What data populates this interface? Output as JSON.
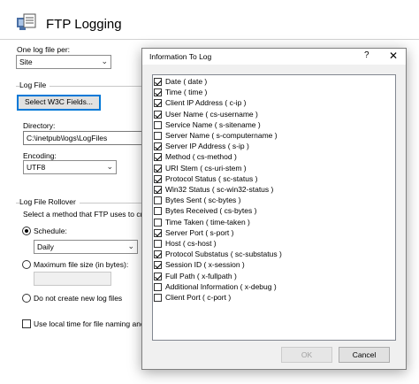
{
  "page": {
    "title": "FTP Logging",
    "one_log_label": "One log file per:",
    "one_log_value": "Site",
    "log_file_group": "Log File",
    "select_fields_button": "Select W3C Fields...",
    "directory_label": "Directory:",
    "directory_value": "C:\\inetpub\\logs\\LogFiles",
    "encoding_label": "Encoding:",
    "encoding_value": "UTF8",
    "rollover_group": "Log File Rollover",
    "rollover_desc": "Select a method that FTP uses to creat",
    "schedule_label": "Schedule:",
    "schedule_value": "Daily",
    "max_size_label": "Maximum file size (in bytes):",
    "no_new_label": "Do not create new log files",
    "local_time_label": "Use local time for file naming and r"
  },
  "dialog": {
    "title": "Information To Log",
    "help_label": "?",
    "close_label": "✕",
    "ok_label": "OK",
    "cancel_label": "Cancel",
    "fields": [
      {
        "label": "Date ( date )",
        "checked": true
      },
      {
        "label": "Time ( time )",
        "checked": true
      },
      {
        "label": "Client IP Address ( c-ip )",
        "checked": true
      },
      {
        "label": "User Name ( cs-username )",
        "checked": true
      },
      {
        "label": "Service Name ( s-sitename )",
        "checked": false
      },
      {
        "label": "Server Name ( s-computername )",
        "checked": false
      },
      {
        "label": "Server IP Address ( s-ip )",
        "checked": true
      },
      {
        "label": "Method ( cs-method )",
        "checked": true
      },
      {
        "label": "URI Stem ( cs-uri-stem )",
        "checked": true
      },
      {
        "label": "Protocol Status ( sc-status )",
        "checked": true
      },
      {
        "label": "Win32 Status ( sc-win32-status )",
        "checked": true
      },
      {
        "label": "Bytes Sent ( sc-bytes )",
        "checked": false
      },
      {
        "label": "Bytes Received ( cs-bytes )",
        "checked": false
      },
      {
        "label": "Time Taken ( time-taken )",
        "checked": false
      },
      {
        "label": "Server Port ( s-port )",
        "checked": true
      },
      {
        "label": "Host ( cs-host )",
        "checked": false
      },
      {
        "label": "Protocol Substatus ( sc-substatus )",
        "checked": true
      },
      {
        "label": "Session ID ( x-session )",
        "checked": true
      },
      {
        "label": "Full Path ( x-fullpath )",
        "checked": true
      },
      {
        "label": "Additional Information ( x-debug )",
        "checked": false
      },
      {
        "label": "Client Port ( c-port )",
        "checked": false
      }
    ]
  },
  "colors": {
    "accent": "#0078d7",
    "dialog_bg": "#f0f0f0"
  }
}
